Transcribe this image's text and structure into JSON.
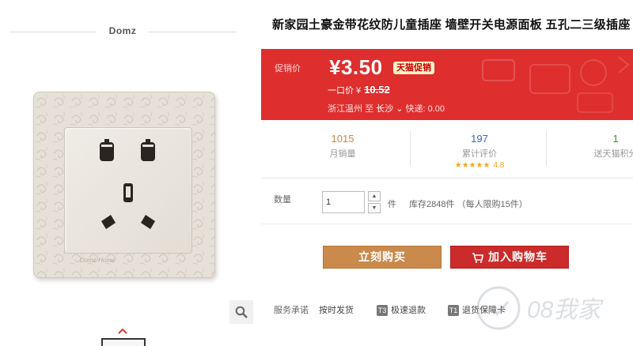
{
  "gallery": {
    "brand": "Domz",
    "plate_brand": "Domz Home"
  },
  "product": {
    "title": "新家园土豪金带花纹防儿童插座 墙壁开关电源面板 五孔二三级插座"
  },
  "promo": {
    "label": "促销价",
    "price": "¥3.50",
    "badge": "天猫促销",
    "original_label": "一口价 ¥",
    "original_price": "10.52",
    "ship_from": "浙江温州",
    "ship_to_label": "至",
    "ship_to": "长沙",
    "shipping_fee": "快递: 0.00",
    "color_bg": "#df2e2e"
  },
  "stats": [
    {
      "value": "1015",
      "label": "月销量",
      "color": "#c9883f"
    },
    {
      "value": "197",
      "label": "累计评价",
      "color": "#2f6bb8",
      "stars": "★★★★★",
      "score": "4.8"
    },
    {
      "value": "1",
      "label": "送天猫积分",
      "color": "#3a8e2c"
    }
  ],
  "quantity": {
    "label": "数量",
    "value": "1",
    "unit": "件",
    "stock": "库存2848件 （每人限购15件）"
  },
  "buttons": {
    "buy": "立刻购买",
    "cart": "加入购物车",
    "buy_color": "#c98a4b",
    "cart_color": "#cc2b2b"
  },
  "services": {
    "label": "服务承诺",
    "items": [
      {
        "tag": "",
        "text": "按时发货"
      },
      {
        "tag": "T3",
        "text": "极速退款"
      },
      {
        "tag": "T1",
        "text": "退货保障卡"
      }
    ]
  },
  "watermark": "08我家"
}
